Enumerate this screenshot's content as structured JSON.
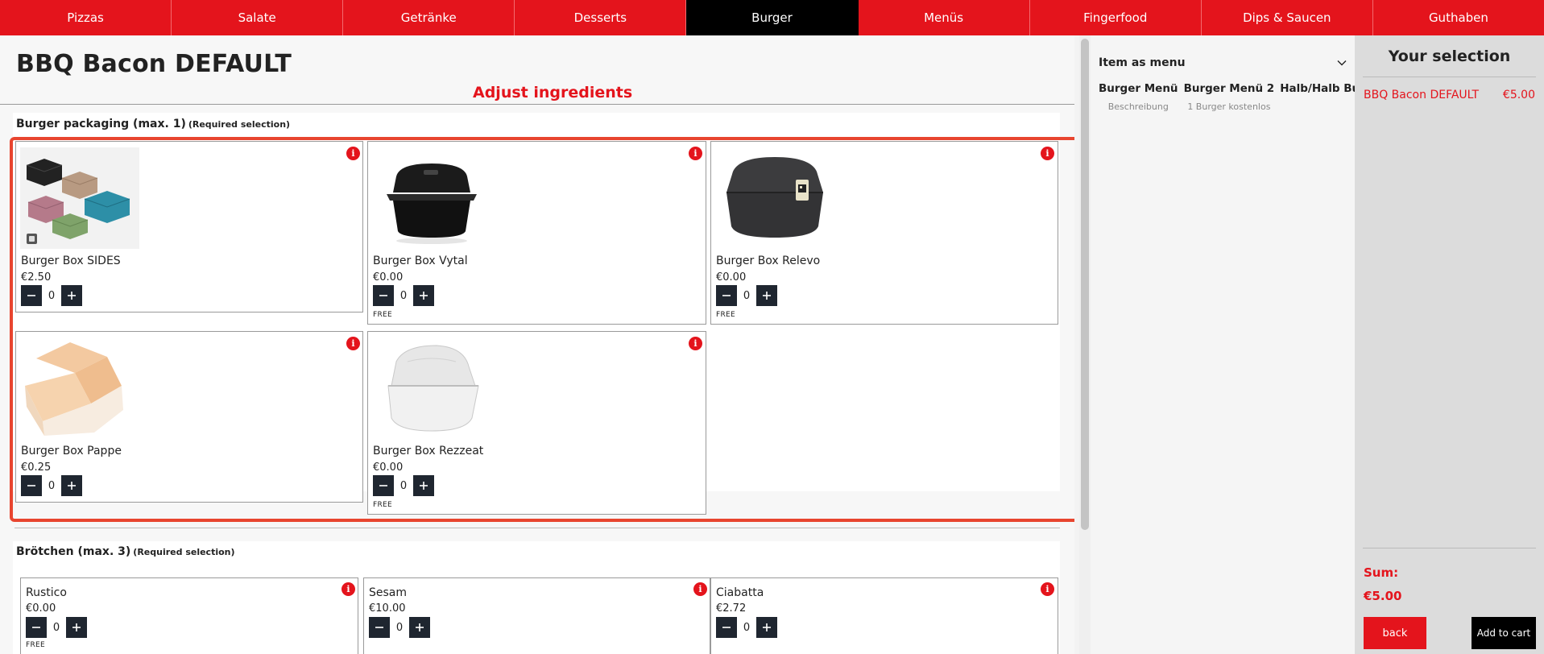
{
  "nav": {
    "tabs": [
      {
        "label": "Pizzas"
      },
      {
        "label": "Salate"
      },
      {
        "label": "Getränke"
      },
      {
        "label": "Desserts"
      },
      {
        "label": "Burger",
        "active": true
      },
      {
        "label": "Menüs"
      },
      {
        "label": "Fingerfood"
      },
      {
        "label": "Dips & Saucen"
      },
      {
        "label": "Guthaben"
      }
    ]
  },
  "product": {
    "title": "BBQ Bacon DEFAULT",
    "adjust_label": "Adjust ingredients"
  },
  "groups": [
    {
      "title": "Burger packaging (max. 1)",
      "required": "(Required selection)",
      "options": [
        {
          "name": "Burger Box SIDES",
          "price": "€2.50",
          "qty": "0",
          "free": ""
        },
        {
          "name": "Burger Box Vytal",
          "price": "€0.00",
          "qty": "0",
          "free": "FREE"
        },
        {
          "name": "Burger Box Relevo",
          "price": "€0.00",
          "qty": "0",
          "free": "FREE"
        },
        {
          "name": "Burger Box Pappe",
          "price": "€0.25",
          "qty": "0",
          "free": ""
        },
        {
          "name": "Burger Box Rezzeat",
          "price": "€0.00",
          "qty": "0",
          "free": "FREE"
        }
      ]
    },
    {
      "title": "Brötchen (max. 3)",
      "required": "(Required selection)",
      "options": [
        {
          "name": "Rustico",
          "price": "€0.00",
          "qty": "0",
          "free": "FREE"
        },
        {
          "name": "Sesam",
          "price": "€10.00",
          "qty": "0",
          "free": ""
        },
        {
          "name": "Ciabatta",
          "price": "€2.72",
          "qty": "0",
          "free": ""
        }
      ]
    }
  ],
  "menu": {
    "heading": "Item as menu",
    "options": [
      {
        "title": "Burger Menü",
        "subtitle": "Beschreibung"
      },
      {
        "title": "Burger Menü 2",
        "subtitle": "1 Burger kostenlos"
      },
      {
        "title": "Halb/Halb Burger",
        "subtitle": ""
      }
    ]
  },
  "selection": {
    "title": "Your selection",
    "items": [
      {
        "name": "BBQ Bacon DEFAULT",
        "price": "€5.00"
      }
    ],
    "sum_label": "Sum:",
    "sum_value": "€5.00",
    "back_label": "back",
    "cart_label": "Add to cart"
  },
  "colors": {
    "brand_red": "#e4141c",
    "highlight_border": "#e8452f",
    "nav_active": "#000000",
    "stepper": "#1f2630"
  },
  "icons": {
    "info": "info-icon",
    "minus": "minus-icon",
    "plus": "plus-icon",
    "menu_toggle": "chevron-down-icon"
  }
}
